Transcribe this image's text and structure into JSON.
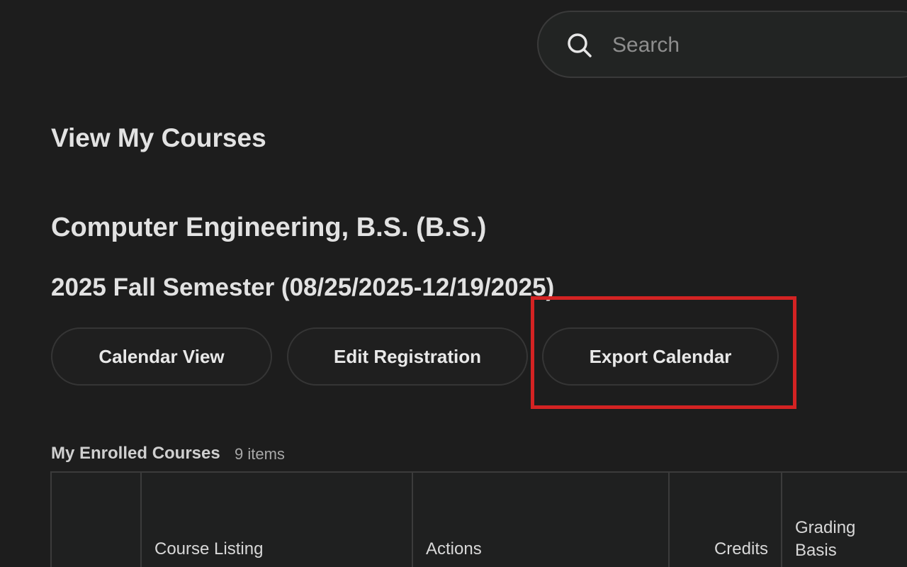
{
  "search": {
    "placeholder": "Search",
    "icon": "search-icon"
  },
  "page": {
    "title": "View My Courses",
    "program": "Computer Engineering, B.S. (B.S.)",
    "semester": "2025 Fall Semester (08/25/2025-12/19/2025)"
  },
  "buttons": {
    "calendar_view": "Calendar View",
    "edit_registration": "Edit Registration",
    "export_calendar": "Export Calendar"
  },
  "highlight": {
    "color": "#d42323",
    "target": "Export Calendar"
  },
  "enrolled": {
    "label": "My Enrolled Courses",
    "count": "9 items",
    "columns": [
      "",
      "Course Listing",
      "Actions",
      "Credits",
      "Grading Basis"
    ]
  },
  "colors": {
    "background": "#1d1d1d",
    "text": "#e2e2e2",
    "border": "#3b3b3b",
    "highlight": "#d42323"
  }
}
